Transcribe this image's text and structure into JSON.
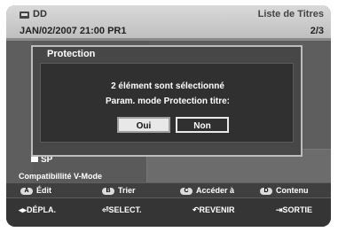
{
  "header": {
    "title": "DD",
    "list_title": "Liste de Titres",
    "datetime": "JAN/02/2007 21:00 PR1",
    "page": "2/3"
  },
  "content": {
    "sp_label": "SP",
    "compat_label": "Compatibillité V-Mode"
  },
  "dialog": {
    "title": "Protection",
    "message_line1": "2 élément sont sélectionné",
    "message_line2": "Param. mode Protection titre:",
    "yes_label": "Oui",
    "no_label": "Non",
    "selected": "Non"
  },
  "color_keys": [
    {
      "key": "A",
      "label": "Édit"
    },
    {
      "key": "B",
      "label": "Trier"
    },
    {
      "key": "C",
      "label": "Accéder à"
    },
    {
      "key": "D",
      "label": "Contenu"
    }
  ],
  "nav": {
    "move": "DÉPLA.",
    "select": "SELECT.",
    "return": "REVENIR",
    "exit": "SORTIE"
  }
}
